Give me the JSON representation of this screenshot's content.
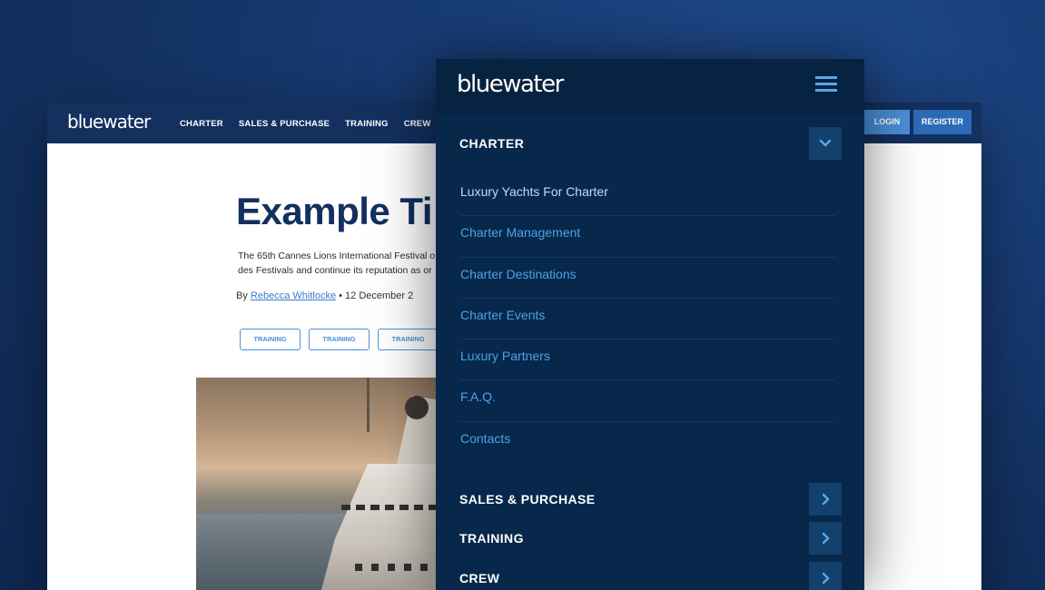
{
  "desktop": {
    "logo": "bluewater",
    "nav": [
      "CHARTER",
      "SALES & PURCHASE",
      "TRAINING",
      "CREW"
    ],
    "login_label": "LOGIN",
    "register_label": "REGISTER",
    "article": {
      "title": "Example Ti",
      "lead_line1": "The 65th Cannes Lions International Festival o",
      "lead_line2": "des Festivals and continue its reputation as or",
      "by": "By",
      "author": "Rebecca Whitlocke",
      "date": "• 12 December 2",
      "tags": [
        "TRAINING",
        "TRAINING",
        "TRAINING"
      ]
    }
  },
  "mobile": {
    "logo": "bluewater",
    "menu_icon": "hamburger-menu-icon",
    "sections": [
      {
        "label": "CHARTER",
        "expanded": true,
        "icon": "chevron-down-icon"
      },
      {
        "label": "SALES & PURCHASE",
        "expanded": false,
        "icon": "chevron-right-icon"
      },
      {
        "label": "TRAINING",
        "expanded": false,
        "icon": "chevron-right-icon"
      },
      {
        "label": "CREW",
        "expanded": false,
        "icon": "chevron-right-icon"
      }
    ],
    "charter_items": [
      "Luxury Yachts For Charter",
      "Charter Management",
      "Charter Destinations",
      "Charter Events",
      "Luxury Partners",
      "F.A.Q.",
      "Contacts"
    ]
  },
  "colors": {
    "background": "#163a70",
    "mobile_bg": "#07284a",
    "link": "#4ea1e8",
    "toggle_bg": "#13416b",
    "login": "#4a90d9",
    "register": "#2d6ab7",
    "navy": "#13305f"
  }
}
